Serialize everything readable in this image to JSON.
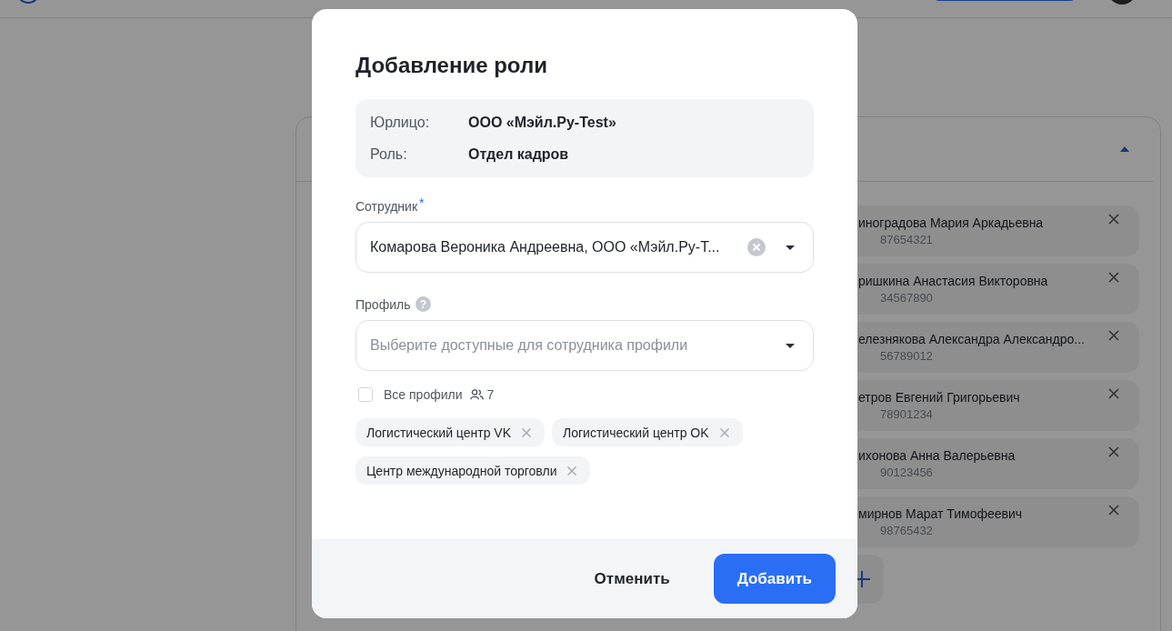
{
  "page": {
    "employees": [
      {
        "name": "иноградова Мария Аркадьевна",
        "id": "87654321"
      },
      {
        "name": "ришкина Анастасия Викторовна",
        "id": "34567890"
      },
      {
        "name": "елезнякова Александра Александро...",
        "id": "56789012"
      },
      {
        "name": "етров Евгений Григорьевич",
        "id": "78901234"
      },
      {
        "name": "ихонова Анна Валерьевна",
        "id": "90123456"
      },
      {
        "name": "мирнов Марат Тимофеевич",
        "id": "98765432"
      }
    ]
  },
  "dialog": {
    "title": "Добавление роли",
    "info": [
      {
        "label": "Юрлицо:",
        "value": "ООО «Мэйл.Ру-Test»"
      },
      {
        "label": "Роль:",
        "value": "Отдел кадров"
      }
    ],
    "employee": {
      "label": "Сотрудник",
      "required_mark": "*",
      "value": "Комарова Вероника Андреевна, ООО «Мэйл.Ру-Т..."
    },
    "profile": {
      "label": "Профиль",
      "help_mark": "?",
      "placeholder": "Выберите доступные для сотрудника профили"
    },
    "all_profiles": {
      "label": "Все профили",
      "checked": false,
      "count": "7"
    },
    "tags": [
      "Логистический центр VK",
      "Логистический центр OK",
      "Центр международной торговли"
    ],
    "buttons": {
      "cancel": "Отменить",
      "submit": "Добавить"
    }
  }
}
